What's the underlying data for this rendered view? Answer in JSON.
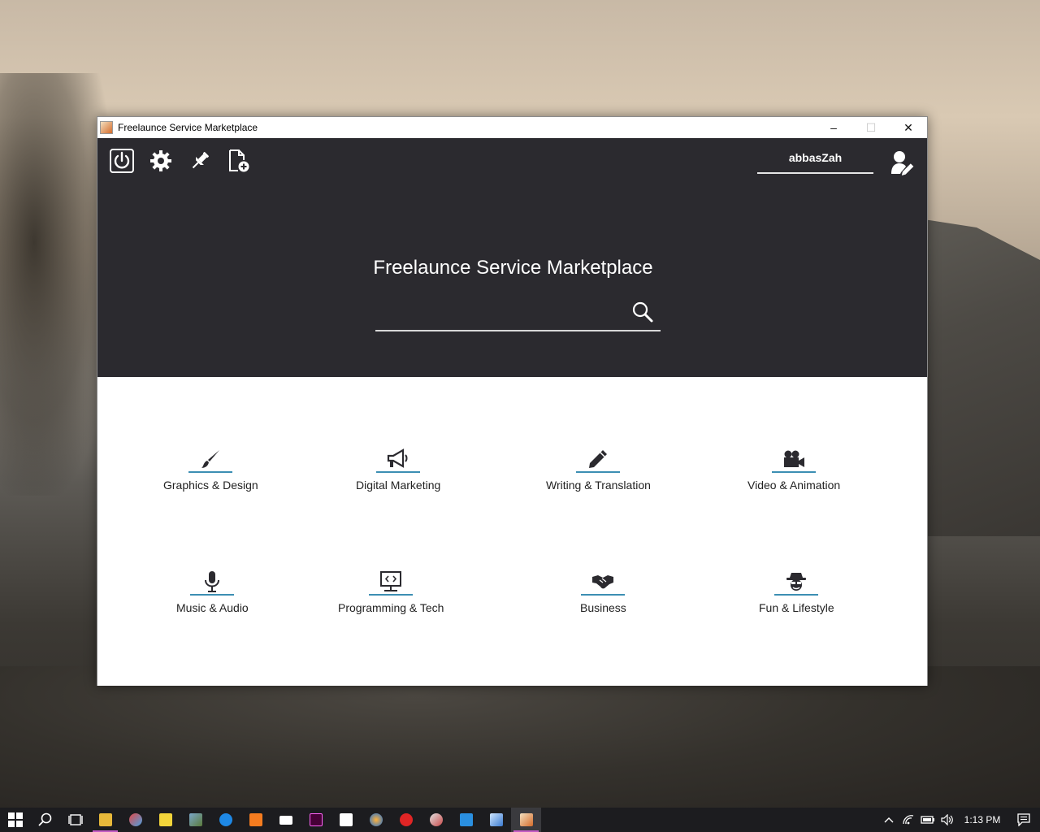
{
  "window": {
    "title": "Freelaunce Service Marketplace",
    "minimize": "–",
    "maximize": "☐",
    "close": "✕"
  },
  "header": {
    "username": "abbasZah",
    "headline": "Freelaunce Service Marketplace",
    "search_value": "",
    "toolbar_icons": [
      "power-icon",
      "gear-icon",
      "pin-icon",
      "new-document-icon"
    ],
    "accent_color": "#3c8fb3",
    "background_color": "#2b2a2f"
  },
  "categories": [
    {
      "label": "Graphics & Design",
      "icon": "paintbrush-icon"
    },
    {
      "label": "Digital Marketing",
      "icon": "megaphone-icon"
    },
    {
      "label": "Writing & Translation",
      "icon": "pen-icon"
    },
    {
      "label": "Video & Animation",
      "icon": "video-camera-icon"
    },
    {
      "label": "Music & Audio",
      "icon": "microphone-icon"
    },
    {
      "label": "Programming & Tech",
      "icon": "code-monitor-icon"
    },
    {
      "label": "Business",
      "icon": "handshake-icon"
    },
    {
      "label": "Fun & Lifestyle",
      "icon": "spy-icon"
    }
  ],
  "taskbar": {
    "clock": "1:13 PM",
    "apps": [
      "start-icon",
      "search-icon",
      "task-view-icon",
      "file-explorer-icon",
      "paint-icon",
      "sticky-notes-icon",
      "photos-icon",
      "edge-icon",
      "xampp-icon",
      "mail-icon",
      "adobe-xd-icon",
      "store-icon",
      "firefox-icon",
      "opera-icon",
      "snipping-icon",
      "vscode-icon",
      "virtualbox-icon",
      "java-app-icon"
    ]
  }
}
